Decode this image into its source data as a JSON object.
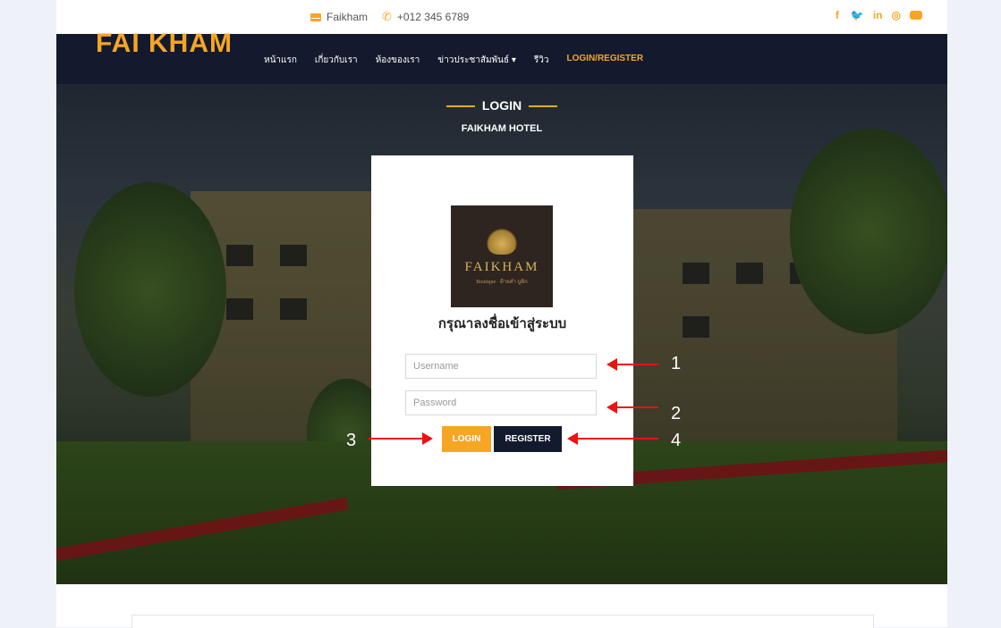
{
  "contact": {
    "email_label": "Faikham",
    "phone_label": "+012 345 6789"
  },
  "social": [
    {
      "icon": "facebook-icon",
      "glyph": "f"
    },
    {
      "icon": "twitter-icon",
      "glyph": "❀"
    },
    {
      "icon": "linkedin-icon",
      "glyph": "in"
    },
    {
      "icon": "instagram-icon",
      "glyph": "◎"
    },
    {
      "icon": "youtube-icon",
      "glyph": ""
    }
  ],
  "brand": {
    "logo_text": "FAI KHAM",
    "accent_color": "#f6a623",
    "nav_bg": "#141a2e"
  },
  "nav": {
    "items": [
      {
        "label": "หน้าแรก"
      },
      {
        "label": "เกี่ยวกับเรา"
      },
      {
        "label": "ห้องของเรา"
      },
      {
        "label": "ข่าวประชาสัมพันธ์ ▾"
      },
      {
        "label": "รีวิว"
      },
      {
        "label": "LOGIN/REGISTER"
      }
    ]
  },
  "hero": {
    "title": "LOGIN",
    "subtitle": "FAIKHAM HOTEL"
  },
  "login_card": {
    "logo_name": "FAIKHAM",
    "logo_tag": "Boutique · ฝ้ายคำ บูติก",
    "title": "กรุณาลงชื่อเข้าสู่ระบบ",
    "username_placeholder": "Username",
    "password_placeholder": "Password",
    "login_label": "LOGIN",
    "register_label": "REGISTER"
  },
  "annotations": {
    "a1": "1",
    "a2": "2",
    "a3": "3",
    "a4": "4"
  }
}
